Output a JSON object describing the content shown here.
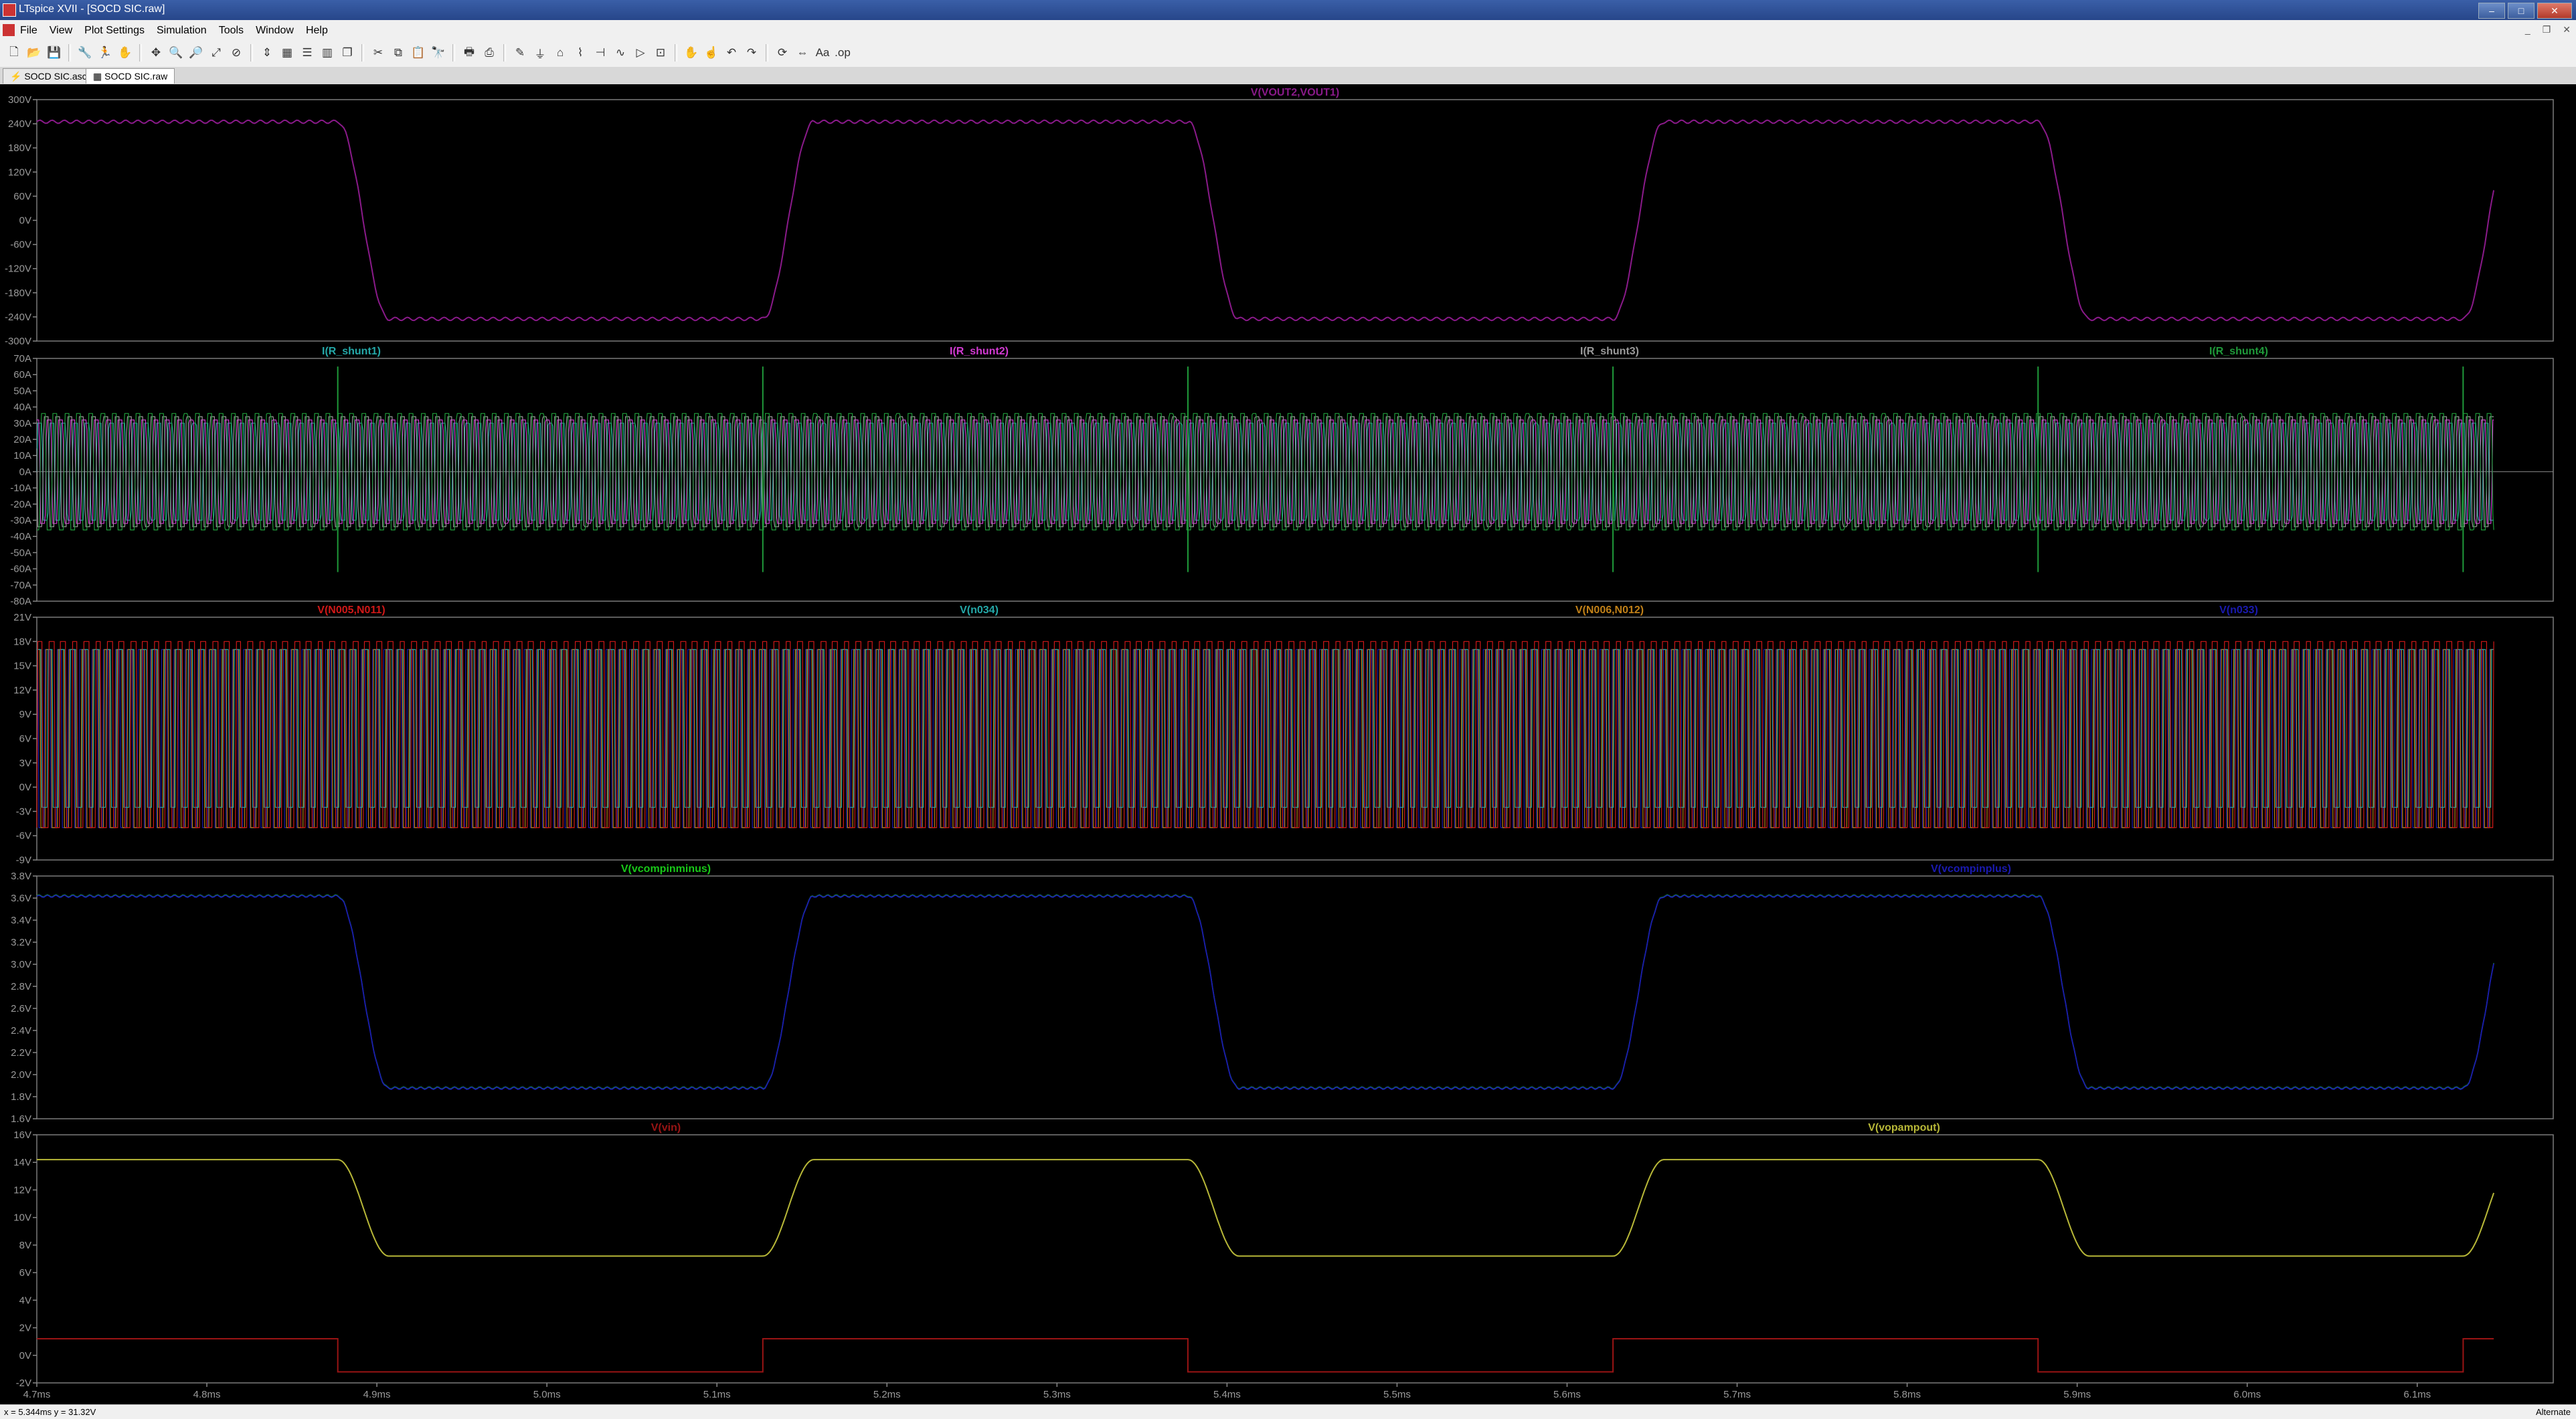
{
  "window": {
    "title": "LTspice XVII - [SOCD SIC.raw]"
  },
  "menubar": {
    "items": [
      "File",
      "View",
      "Plot Settings",
      "Simulation",
      "Tools",
      "Window",
      "Help"
    ]
  },
  "toolbar": {
    "icons": [
      "new-icon",
      "open-icon",
      "save-icon",
      "control-panel-icon",
      "run-icon",
      "halt-icon",
      "pan-icon",
      "zoom-in-icon",
      "zoom-out-icon",
      "zoom-fit-icon",
      "zoom-cancel-icon",
      "autorange-icon",
      "grid-icon",
      "tile-horizontal-icon",
      "tile-vertical-icon",
      "cascade-icon",
      "cut-icon",
      "copy-icon",
      "paste-icon",
      "find-icon",
      "print-icon",
      "print-preview-icon",
      "draw-wire-icon",
      "ground-icon",
      "label-icon",
      "resistor-icon",
      "capacitor-icon",
      "inductor-icon",
      "diode-icon",
      "component-icon",
      "move-icon",
      "drag-icon",
      "undo-icon",
      "redo-icon",
      "rotate-icon",
      "mirror-icon",
      "text-icon",
      "spice-directive-icon"
    ]
  },
  "tabs": [
    {
      "label": "SOCD SIC.asc",
      "active": false
    },
    {
      "label": "SOCD SIC.raw",
      "active": true
    }
  ],
  "x_axis": {
    "ticks": [
      "4.7ms",
      "4.8ms",
      "4.9ms",
      "5.0ms",
      "5.1ms",
      "5.2ms",
      "5.3ms",
      "5.4ms",
      "5.5ms",
      "5.6ms",
      "5.7ms",
      "5.8ms",
      "5.9ms",
      "6.0ms",
      "6.1ms"
    ]
  },
  "panes": [
    {
      "ticks": [
        "300V",
        "240V",
        "180V",
        "120V",
        "60V",
        "0V",
        "-60V",
        "-120V",
        "-180V",
        "-240V",
        "-300V"
      ],
      "ymin": -300,
      "ymax": 300,
      "traces": [
        {
          "name": "V(VOUT2,VOUT1)",
          "color": "#8a1a8a"
        }
      ]
    },
    {
      "ticks": [
        "70A",
        "60A",
        "50A",
        "40A",
        "30A",
        "20A",
        "10A",
        "0A",
        "-10A",
        "-20A",
        "-30A",
        "-40A",
        "-50A",
        "-60A",
        "-70A",
        "-80A"
      ],
      "ymin": -80,
      "ymax": 70,
      "traces": [
        {
          "name": "I(R_shunt1)",
          "color": "#24a8a8"
        },
        {
          "name": "I(R_shunt2)",
          "color": "#d23ad2"
        },
        {
          "name": "I(R_shunt3)",
          "color": "#9a9a9a"
        },
        {
          "name": "I(R_shunt4)",
          "color": "#1f9a3a"
        }
      ]
    },
    {
      "ticks": [
        "21V",
        "18V",
        "15V",
        "12V",
        "9V",
        "6V",
        "3V",
        "0V",
        "-3V",
        "-6V",
        "-9V"
      ],
      "ymin": -9,
      "ymax": 21,
      "traces": [
        {
          "name": "V(N005,N011)",
          "color": "#d01818"
        },
        {
          "name": "V(n034)",
          "color": "#24a8a8"
        },
        {
          "name": "V(N006,N012)",
          "color": "#c08018"
        },
        {
          "name": "V(n033)",
          "color": "#1a1ab0"
        }
      ]
    },
    {
      "ticks": [
        "3.8V",
        "3.6V",
        "3.4V",
        "3.2V",
        "3.0V",
        "2.8V",
        "2.6V",
        "2.4V",
        "2.2V",
        "2.0V",
        "1.8V",
        "1.6V"
      ],
      "ymin": 1.6,
      "ymax": 3.8,
      "traces": [
        {
          "name": "V(vcompinminus)",
          "color": "#18c818"
        },
        {
          "name": "V(vcompinplus)",
          "color": "#1a1ab0"
        }
      ]
    },
    {
      "ticks": [
        "16V",
        "14V",
        "12V",
        "10V",
        "8V",
        "6V",
        "4V",
        "2V",
        "0V",
        "-2V"
      ],
      "ymin": -2,
      "ymax": 16,
      "traces": [
        {
          "name": "V(vin)",
          "color": "#9a1414"
        },
        {
          "name": "V(vopampout)",
          "color": "#b8b838"
        }
      ]
    }
  ],
  "status": {
    "cursor": "x = 5.344ms   y = 31.32V",
    "mode": "Alternate"
  }
}
